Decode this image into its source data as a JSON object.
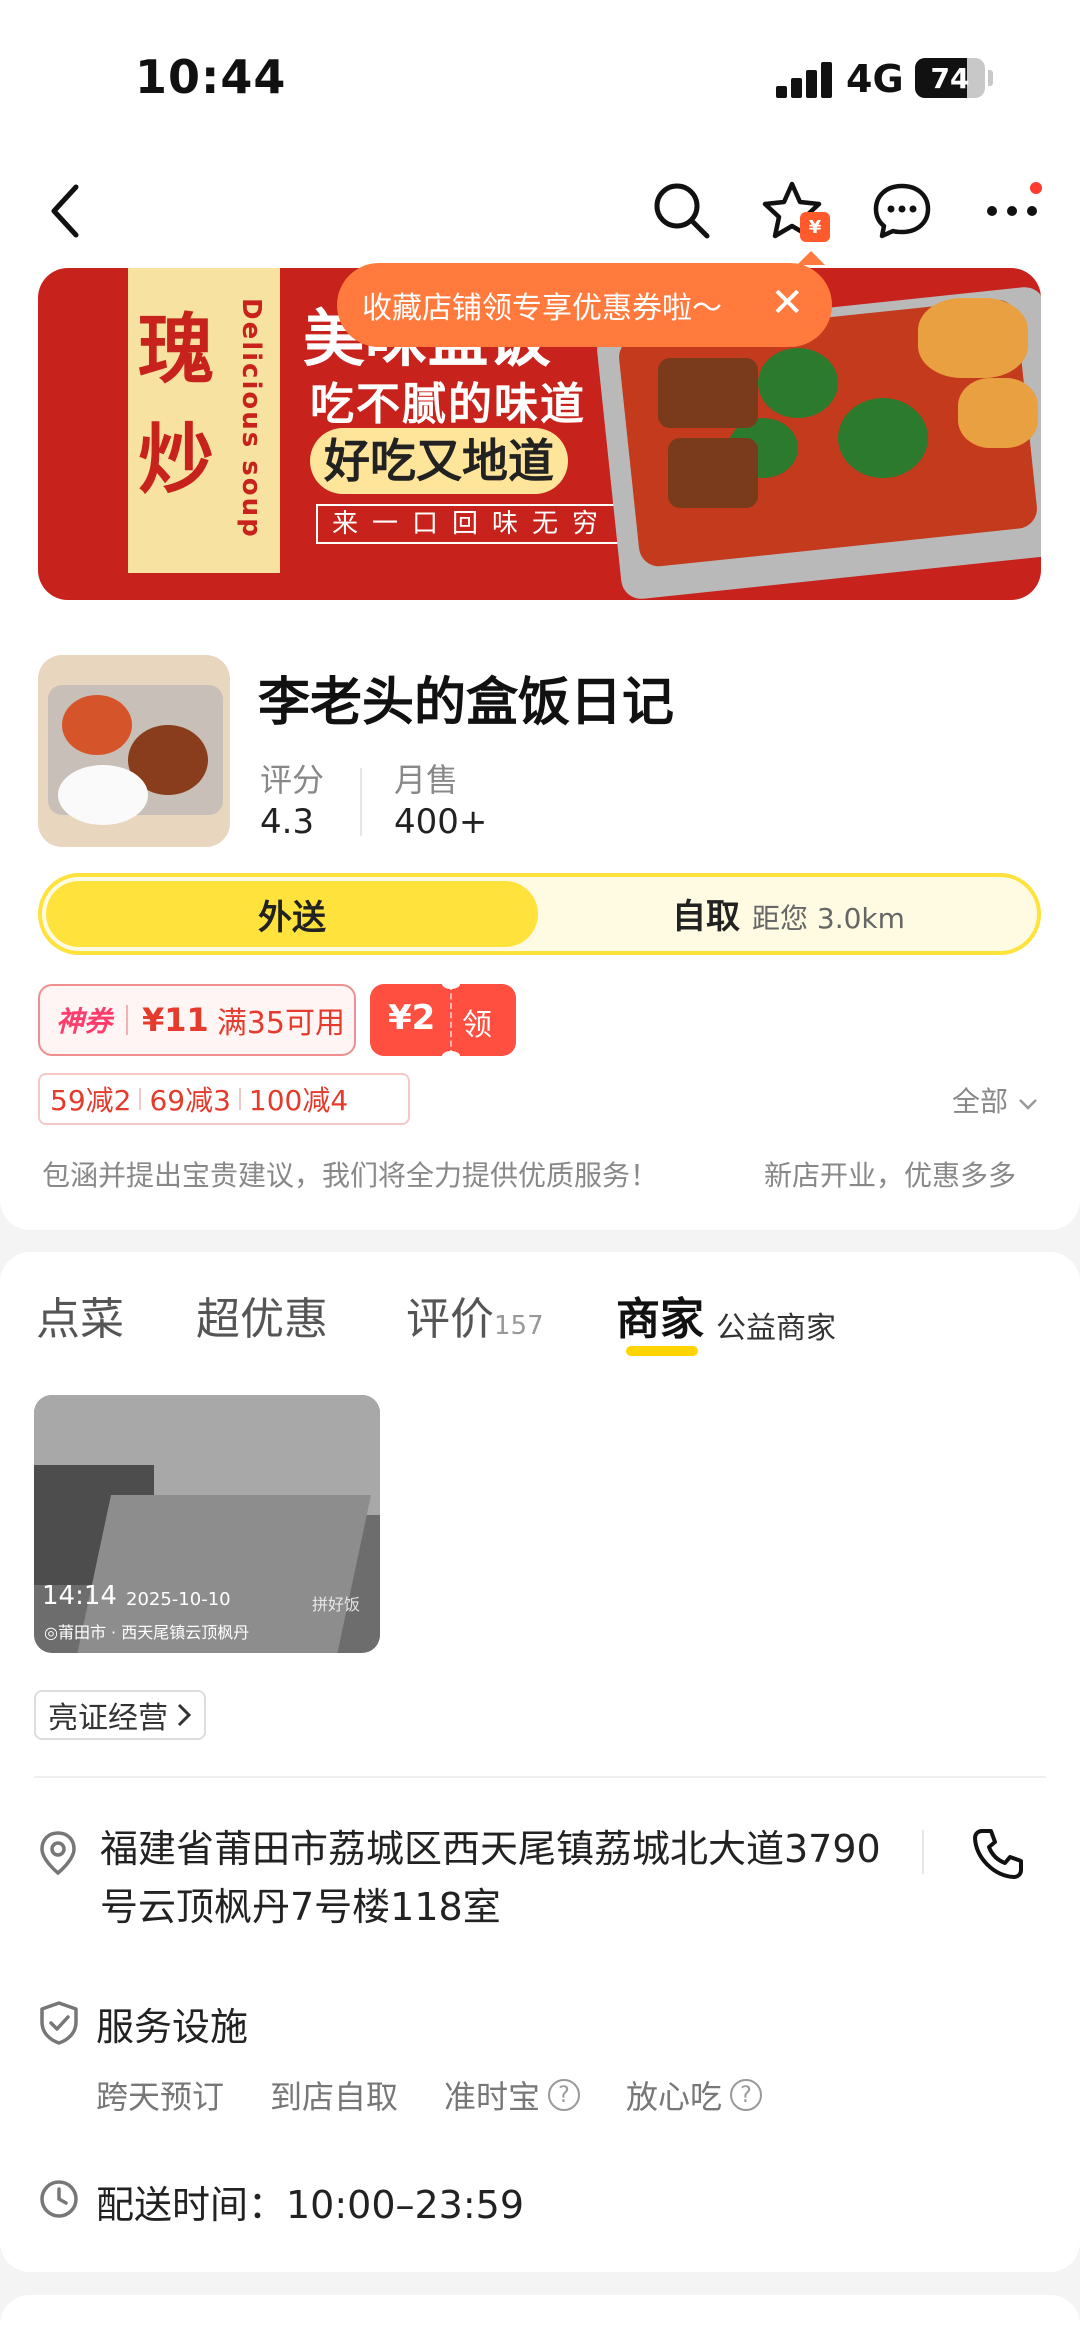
{
  "status_bar": {
    "time": "10:44",
    "network": "4G",
    "battery": "74",
    "battery_level": 0.74
  },
  "header": {
    "icons": [
      "back-arrow-icon",
      "search-icon",
      "favorite-star-icon",
      "chat-bubble-icon",
      "more-icon"
    ],
    "favorite_badge": "¥"
  },
  "banner": {
    "left_chars": [
      "瑰",
      "炒"
    ],
    "vertical_text": "Delicious soup",
    "line1": "美味盒饭",
    "line2": "吃不腻的味道",
    "line3": "好吃又地道",
    "line4": "来一口回味无穷"
  },
  "tooltip": {
    "text": "收藏店铺领专享优惠券啦～",
    "close": "✕"
  },
  "store": {
    "name": "李老头的盒饭日记",
    "rating_label": "评分",
    "rating": "4.3",
    "monthly_sales_label": "月售",
    "monthly_sales": "400+"
  },
  "delivery_toggle": {
    "delivery": "外送",
    "pickup": "自取",
    "distance": "距您 3.0km"
  },
  "coupons": {
    "god_coupon_label": "神券",
    "god_coupon_amount": "¥11",
    "god_coupon_condition": "满35可用",
    "store_coupon_amount": "¥2",
    "store_coupon_action": "领"
  },
  "discounts": [
    "59减2",
    "69减3",
    "100减4"
  ],
  "all_link": "全部",
  "notices": {
    "left": "包涵并提出宝贵建议，我们将全力提供优质服务！",
    "right": "新店开业，优惠多多"
  },
  "tabs": [
    {
      "label": "点菜",
      "count": ""
    },
    {
      "label": "超优惠",
      "count": ""
    },
    {
      "label": "评价",
      "count": "157"
    },
    {
      "label": "商家",
      "count": ""
    }
  ],
  "active_tab_sub": "公益商家",
  "kitchen_photo": {
    "time": "14:14",
    "date": "2025-10-10",
    "location": "◎莆田市 · 西天尾镇云顶枫丹",
    "brand": "拼好饭"
  },
  "license_button": "亮证经营",
  "address": "福建省莆田市荔城区西天尾镇荔城北大道3790号云顶枫丹7号楼118室",
  "services": {
    "title": "服务设施",
    "tags": [
      "跨天预订",
      "到店自取",
      "准时宝",
      "放心吃"
    ]
  },
  "delivery_time": "配送时间：10:00–23:59"
}
